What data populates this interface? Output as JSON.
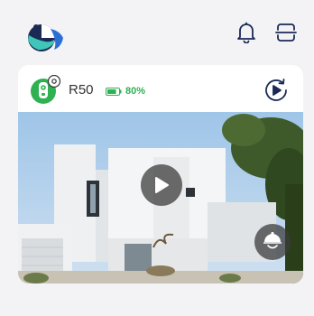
{
  "colors": {
    "brand_navy": "#1b2a55",
    "brand_teal": "#3fc6b8",
    "brand_blue": "#2b6fd6",
    "accent_green": "#2fb152",
    "background": "#f3f3f5",
    "card": "#ffffff"
  },
  "header": {
    "icons": [
      "notification-bell-icon",
      "scan-icon"
    ]
  },
  "device_card": {
    "name": "R50",
    "battery_percent": 80,
    "battery_label": "80%",
    "icons": [
      "device-settings-icon",
      "playback-icon",
      "play-icon",
      "ptz-control-icon"
    ]
  }
}
